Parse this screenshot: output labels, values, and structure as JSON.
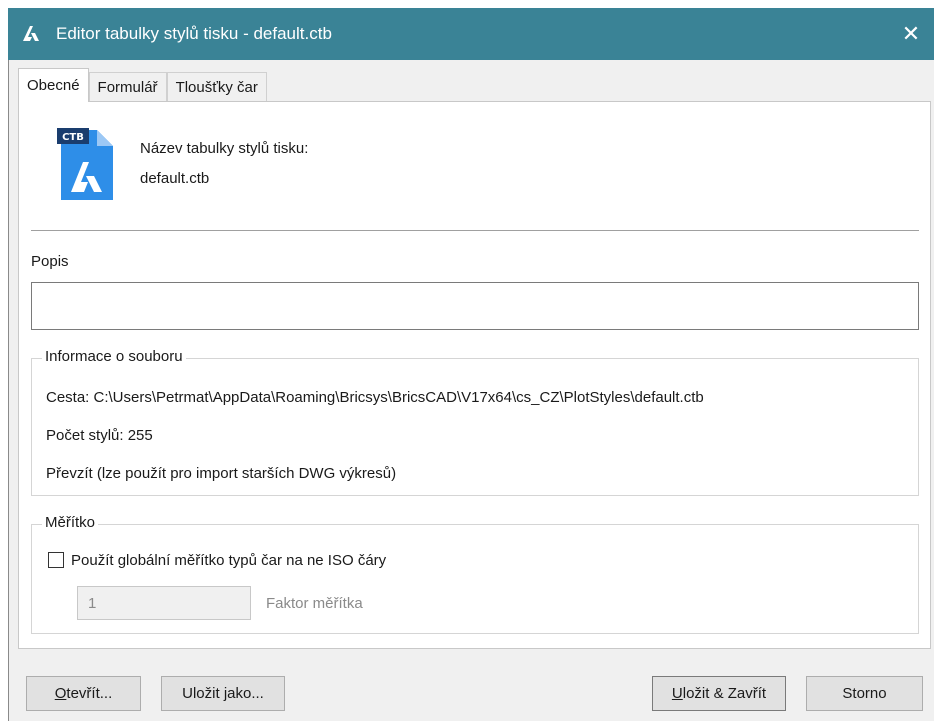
{
  "window": {
    "title": "Editor tabulky stylů tisku - default.ctb",
    "close_symbol": "✕",
    "app_icon": "bricscad-logo-icon",
    "titlebar_color": "#3a8396"
  },
  "tabs": [
    {
      "label": "Obecné",
      "active": true
    },
    {
      "label": "Formulář",
      "active": false
    },
    {
      "label": "Tloušťky čar",
      "active": false
    }
  ],
  "general": {
    "file_icon": "ctb-file-icon",
    "file_badge": "CTB",
    "name_label": "Název tabulky stylů tisku:",
    "name_value": "default.ctb",
    "description_label": "Popis",
    "description_value": ""
  },
  "file_info": {
    "legend": "Informace o souboru",
    "path": "Cesta: C:\\Users\\Petrmat\\AppData\\Roaming\\Bricsys\\BricsCAD\\V17x64\\cs_CZ\\PlotStyles\\default.ctb",
    "style_count": "Počet stylů: 255",
    "convert": "Převzít (lze použít pro import starších DWG výkresů)"
  },
  "scale": {
    "legend": "Měřítko",
    "checkbox_label": "Použít globální měřítko typů čar na ne ISO čáry",
    "checked": false,
    "factor_value": "1",
    "factor_label": "Faktor měřítka"
  },
  "buttons": {
    "open_first": "O",
    "open_rest": "tevřít...",
    "save_as": "Uložit jako...",
    "save_close_first": "U",
    "save_close_rest": "ložit & Zavřít",
    "cancel": "Storno"
  }
}
